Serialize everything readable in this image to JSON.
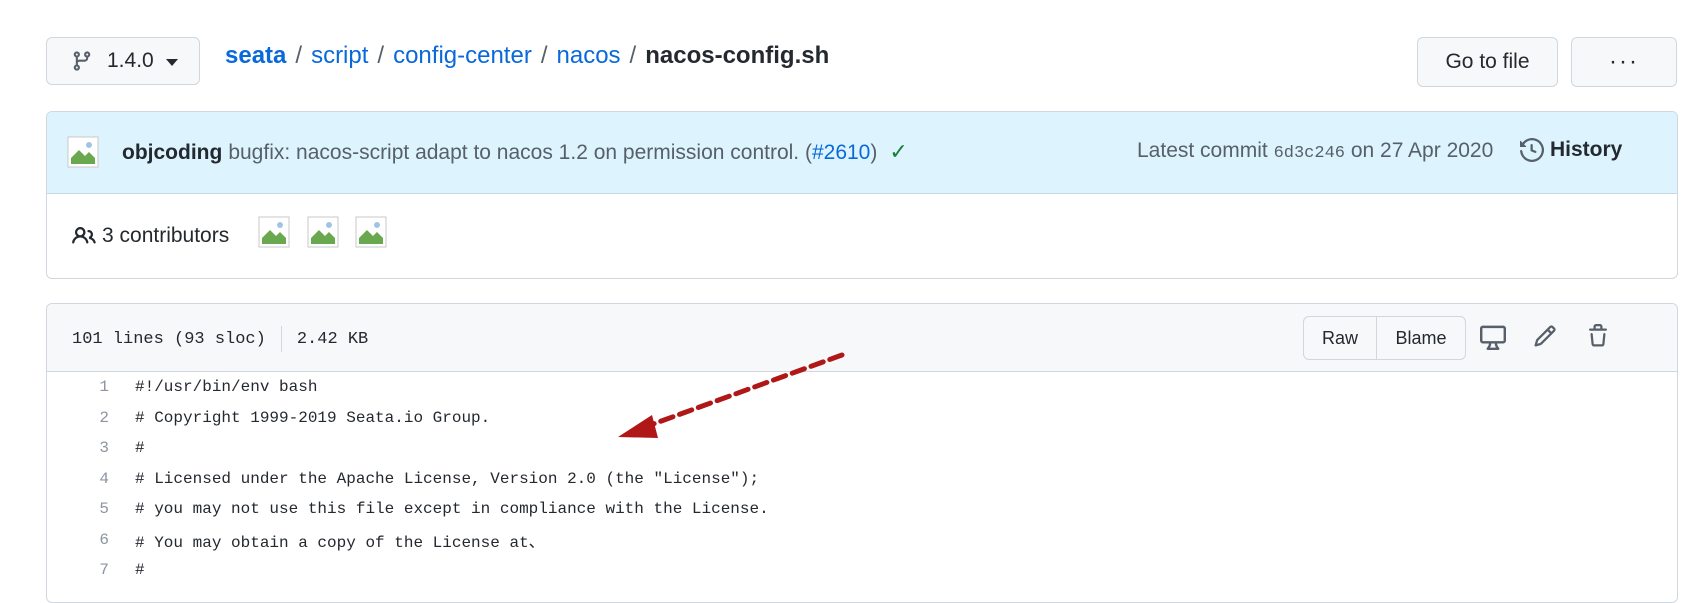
{
  "branch": {
    "name": "1.4.0"
  },
  "breadcrumb": {
    "root": "seata",
    "parts": [
      "script",
      "config-center",
      "nacos"
    ],
    "file": "nacos-config.sh",
    "separator": "/"
  },
  "toolbar": {
    "go_to_file": "Go to file",
    "more": "···"
  },
  "commit": {
    "author": "objcoding",
    "message": "bugfix: nacos-script adapt to nacos 1.2 on permission control. (",
    "pr": "#2610",
    "message_end": ")",
    "status": "✓",
    "latest_prefix": "Latest commit",
    "sha": "6d3c246",
    "date": "on 27 Apr 2020",
    "history": "History"
  },
  "contributors": {
    "label": "3 contributors"
  },
  "file": {
    "lines_info": "101 lines (93 sloc)",
    "size": "2.42 KB",
    "raw": "Raw",
    "blame": "Blame"
  },
  "code": [
    {
      "n": "1",
      "text": "#!/usr/bin/env bash"
    },
    {
      "n": "2",
      "text": "# Copyright 1999-2019 Seata.io Group."
    },
    {
      "n": "3",
      "text": "#"
    },
    {
      "n": "4",
      "text": "# Licensed under the Apache License, Version 2.0 (the \"License\");"
    },
    {
      "n": "5",
      "text": "# you may not use this file except in compliance with the License."
    },
    {
      "n": "6",
      "text": "# You may obtain a copy of the License at、"
    },
    {
      "n": "7",
      "text": "#"
    }
  ],
  "colors": {
    "link": "#0969da",
    "commit_bg": "#ddf4ff",
    "success": "#1a7f37",
    "annotation_arrow": "#b01818"
  },
  "icons": [
    "git-branch-icon",
    "caret-down-icon",
    "check-icon",
    "history-icon",
    "people-icon",
    "desktop-icon",
    "pencil-icon",
    "trash-icon",
    "avatar-broken-image"
  ]
}
